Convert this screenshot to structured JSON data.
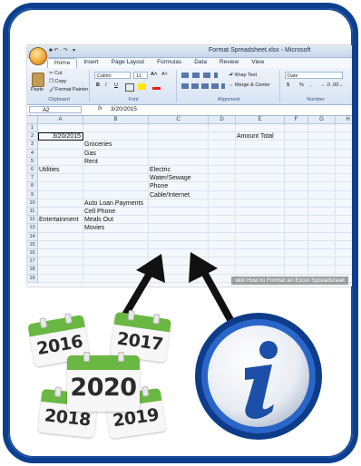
{
  "excel": {
    "title": "Format Spreadsheet.xlsx - Microsoft",
    "quick_access": "■ ↶ · ↷ · ▾",
    "menus": [
      "Home",
      "Insert",
      "Page Layout",
      "Formulas",
      "Data",
      "Review",
      "View"
    ],
    "ribbon": {
      "clipboard": {
        "paste": "Paste",
        "cut": "Cut",
        "copy": "Copy",
        "format_painter": "Format Painter",
        "label": "Clipboard"
      },
      "font": {
        "name": "Calibri",
        "size": "11",
        "grow": "A˄",
        "shrink": "A˅",
        "bold": "B",
        "italic": "I",
        "underline": "U",
        "label": "Font"
      },
      "alignment": {
        "wrap": "Wrap Text",
        "merge": "Merge & Center",
        "label": "Alignment"
      },
      "number": {
        "format": "Date",
        "currency": "$",
        "percent": "%",
        "comma": ",",
        "label": "Number"
      }
    },
    "name_box": "A2",
    "fx": "fx",
    "formula_value": "3/20/2015",
    "columns": [
      "A",
      "B",
      "C",
      "D",
      "E",
      "F",
      "G",
      "H"
    ],
    "rows": [
      "1",
      "2",
      "3",
      "4",
      "5",
      "6",
      "7",
      "8",
      "9",
      "10",
      "11",
      "12",
      "13",
      "14",
      "15",
      "16",
      "17",
      "18",
      "19"
    ],
    "cells": {
      "A2": "3/20/2015",
      "E2": "Amount Total",
      "B3": "Groceries",
      "B4": "Gas",
      "B5": "Rent",
      "A6": "Utilities",
      "C6": "Electric",
      "C7": "Water/Sewage",
      "C8": "Phone",
      "C9": "Cable/Internet",
      "B10": "Auto Loan Payments",
      "B11": "Cell Phone",
      "A12": "Entertainment",
      "B12": "Meals Out",
      "B13": "Movies"
    },
    "watermark": "wiki How to Format an Excel Spreadsheet"
  },
  "calendars": [
    "2016",
    "2017",
    "2020",
    "2018",
    "2019"
  ],
  "colors": {
    "frame": "#0d3f8f",
    "calendar_bar": "#6ab743",
    "info_ring": "#1b55b8",
    "arrow": "#111111"
  }
}
